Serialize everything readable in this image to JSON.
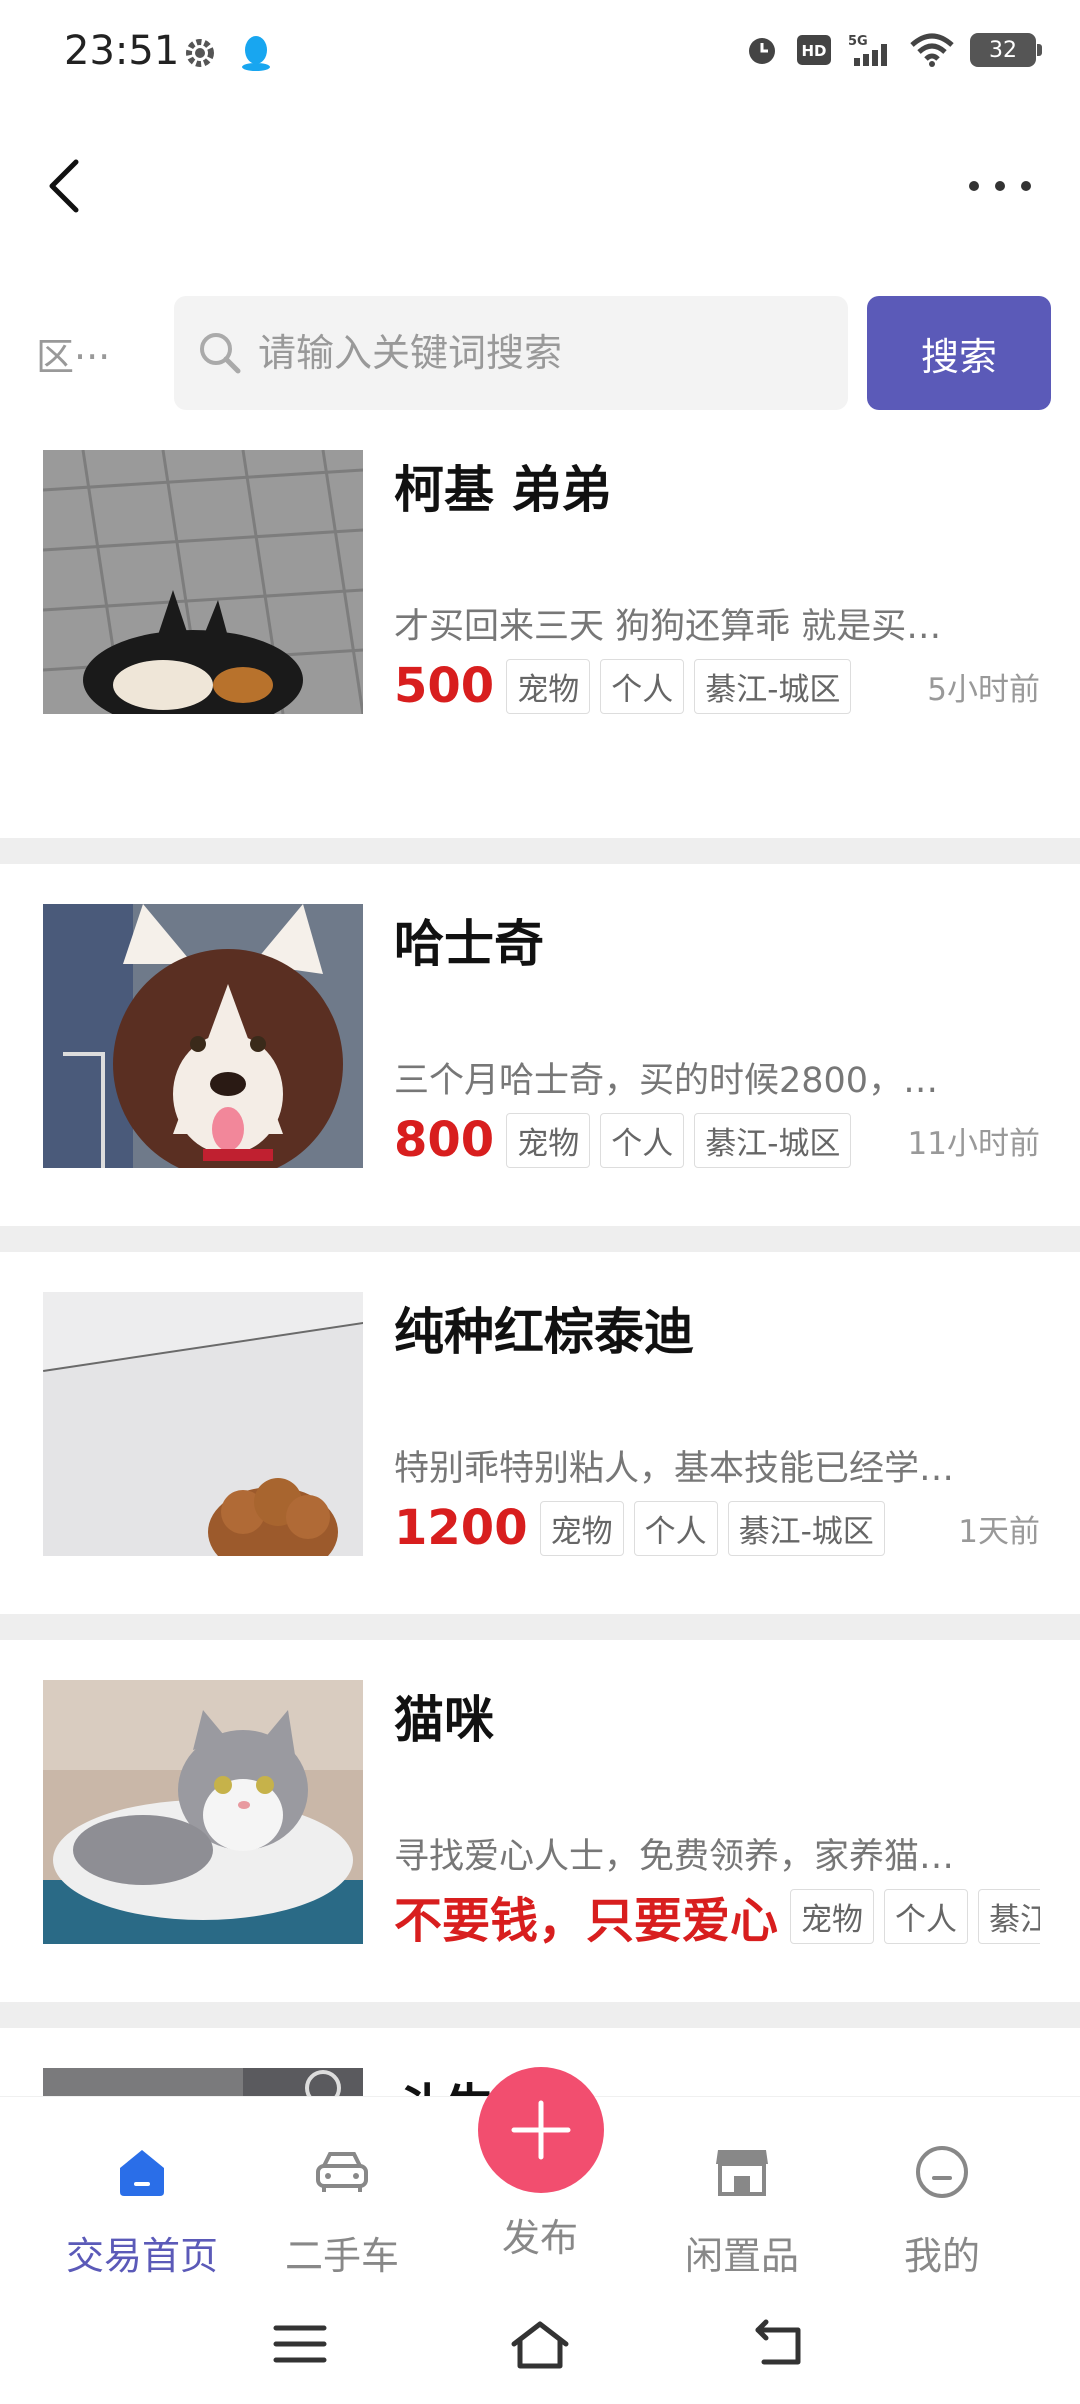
{
  "status_bar": {
    "time": "23:51",
    "battery": "32",
    "icons": [
      "settings-icon",
      "qq-icon",
      "alarm-icon",
      "hd-icon",
      "signal-5g-icon",
      "wifi-icon",
      "battery-icon"
    ]
  },
  "search": {
    "region": "区···",
    "placeholder": "请输入关键词搜索",
    "button_label": "搜索"
  },
  "items": [
    {
      "title": "柯基 弟弟",
      "desc": "才买回来三天 狗狗还算乖 就是买…",
      "price": "500",
      "tags": [
        "宠物",
        "个人",
        "綦江-城区"
      ],
      "time": "5小时前"
    },
    {
      "title": "哈士奇",
      "desc": "三个月哈士奇，买的时候2800，…",
      "price": "800",
      "tags": [
        "宠物",
        "个人",
        "綦江-城区"
      ],
      "time": "11小时前"
    },
    {
      "title": "纯种红棕泰迪",
      "desc": "特别乖特别粘人，基本技能已经学…",
      "price": "1200",
      "tags": [
        "宠物",
        "个人",
        "綦江-城区"
      ],
      "time": "1天前"
    },
    {
      "title": "猫咪",
      "desc": "寻找爱心人士，免费领养，家养猫…",
      "price": "不要钱，只要爱心",
      "tags": [
        "宠物",
        "个人",
        "綦江-城区"
      ],
      "time": ""
    },
    {
      "title": "斗牛犬"
    }
  ],
  "tabs": [
    {
      "label": "交易首页",
      "icon": "home-icon"
    },
    {
      "label": "二手车",
      "icon": "car-icon"
    },
    {
      "label": "发布",
      "icon": "plus-icon"
    },
    {
      "label": "闲置品",
      "icon": "store-icon"
    },
    {
      "label": "我的",
      "icon": "profile-icon"
    }
  ],
  "colors": {
    "accent": "#5b5ab8",
    "price": "#d81e1e",
    "publish": "#f24e6f"
  }
}
